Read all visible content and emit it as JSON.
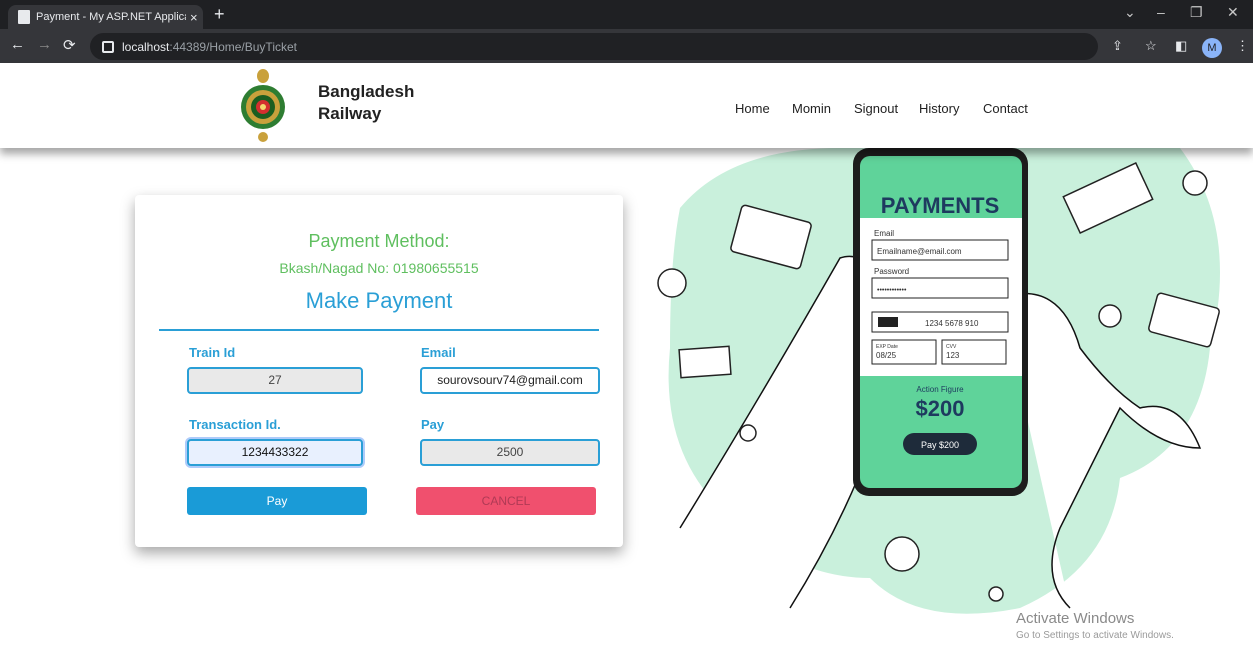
{
  "browser": {
    "tab_title": "Payment - My ASP.NET Applicatio",
    "tab_close": "×",
    "new_tab": "+",
    "url_host": "localhost",
    "url_path": ":44389/Home/BuyTicket",
    "profile_initial": "M"
  },
  "site": {
    "brand_line1": "Bangladesh",
    "brand_line2": "Railway",
    "nav": [
      "Home",
      "Momin",
      "Signout",
      "History",
      "Contact"
    ]
  },
  "payment": {
    "method_title": "Payment Method:",
    "method_detail": "Bkash/Nagad No: 01980655515",
    "heading": "Make Payment",
    "train_id_label": "Train Id",
    "train_id_value": "27",
    "email_label": "Email",
    "email_value": "sourovsourv74@gmail.com",
    "transaction_label": "Transaction Id.",
    "transaction_value": "1234433322",
    "pay_label": "Pay",
    "pay_value": "2500",
    "pay_button": "Pay",
    "cancel_button": "CANCEL"
  },
  "illustration": {
    "phone_title": "PAYMENTS",
    "email_label": "Email",
    "email_placeholder": "Emailname@email.com",
    "password_label": "Password",
    "password_mask": "••••••••••••",
    "card_number": "1234 5678 910",
    "exp_label": "EXP Date",
    "exp_value": "08/25",
    "cvv_label": "CVV",
    "cvv_value": "123",
    "product": "Action Figure",
    "amount": "$200",
    "pay_cta": "Pay $200"
  },
  "watermark": {
    "line1": "Activate Windows",
    "line2": "Go to Settings to activate Windows."
  },
  "colors": {
    "accent_blue": "#2a9fd6",
    "accent_green": "#5fbf5f",
    "cancel_red": "#f0506e",
    "mint": "#c9f0dc"
  }
}
